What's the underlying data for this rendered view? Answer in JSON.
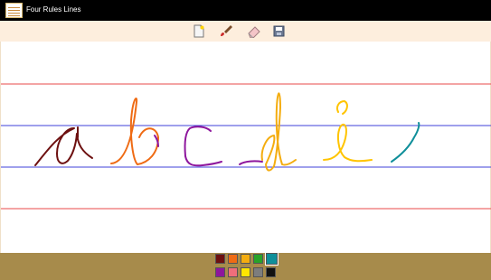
{
  "app": {
    "title": "Four Rules Lines"
  },
  "toolbar": {
    "tools": [
      {
        "name": "new-page-icon"
      },
      {
        "name": "brush-icon"
      },
      {
        "name": "eraser-icon"
      },
      {
        "name": "save-icon"
      }
    ]
  },
  "canvas": {
    "guide_line_colors": {
      "outer": "#e84a4a",
      "inner": "#3f40d8"
    }
  },
  "palette": {
    "selected": "#0f8f9a",
    "colors": [
      "#6d1010",
      "#ef6b14",
      "#f4ad10",
      "#29a329",
      "#0f8f9a",
      "#8e169d",
      "#f06e7b",
      "#ffe600",
      "#7d7d7d",
      "#111111"
    ]
  }
}
